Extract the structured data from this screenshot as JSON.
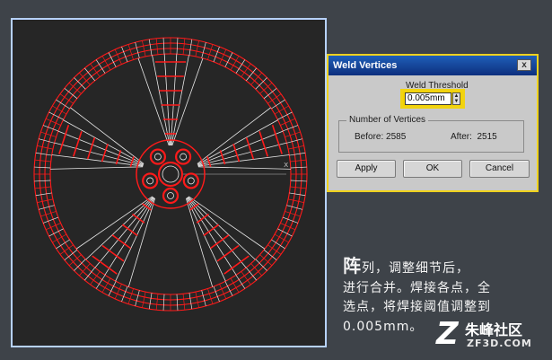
{
  "dialog": {
    "title": "Weld Vertices",
    "close_glyph": "x",
    "threshold_label": "Weld Threshold",
    "threshold_value": "0.005mm",
    "group_title": "Number of Vertices",
    "before": "Before: 2585",
    "after": "After:  2515",
    "apply_label": "Apply",
    "ok_label": "OK",
    "cancel_label": "Cancel"
  },
  "viewport": {
    "axis_label": "x",
    "wire_color": "#e8e8e8",
    "vertex_color": "#ff1a1a",
    "spoke_count": 5
  },
  "caption": {
    "lead_char": "阵",
    "line1_rest": "列，调整细节后，",
    "line2": "进行合并。焊接各点，全",
    "line3": "选点，将焊接阈值调整到",
    "line4": "0.005mm。"
  },
  "logo": {
    "name": "朱峰社区",
    "domain": "ZF3D.COM"
  },
  "colors": {
    "background": "#3e4349",
    "highlight": "#f1d312",
    "titlebar": "#0d2f7e"
  }
}
